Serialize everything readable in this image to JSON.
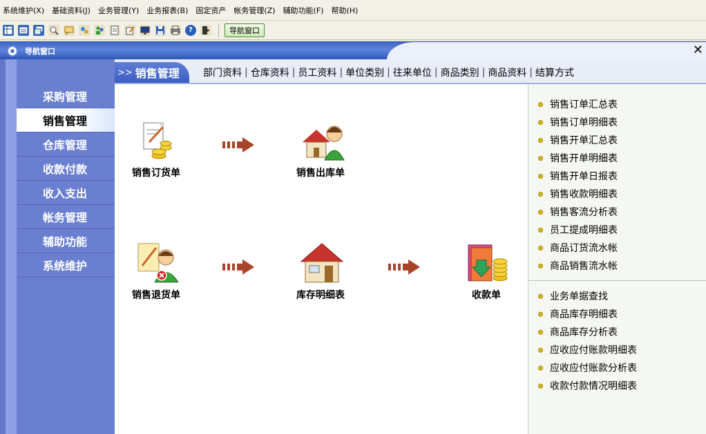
{
  "menu": [
    "系统维护(X)",
    "基础资料(J)",
    "业务管理(Y)",
    "业务报表(B)",
    "固定资产",
    "帐务管理(Z)",
    "辅助功能(F)",
    "帮助(H)"
  ],
  "toolbar": {
    "icons": [
      "grid-icon",
      "form-icon",
      "window-icon",
      "search-icon",
      "message-icon",
      "tools-icon",
      "users-icon",
      "print-preview-icon",
      "edit-icon",
      "monitor-icon",
      "save-icon",
      "printer-icon",
      "help-icon",
      "exit-icon"
    ],
    "nav_button": "导航窗口"
  },
  "window": {
    "title": "导航窗口",
    "close": "✕"
  },
  "sidebar": {
    "items": [
      {
        "label": "采购管理",
        "active": false
      },
      {
        "label": "销售管理",
        "active": true
      },
      {
        "label": "仓库管理",
        "active": false
      },
      {
        "label": "收款付款",
        "active": false
      },
      {
        "label": "收入支出",
        "active": false
      },
      {
        "label": "帐务管理",
        "active": false
      },
      {
        "label": "辅助功能",
        "active": false
      },
      {
        "label": "系统维护",
        "active": false
      }
    ]
  },
  "topnav": {
    "chevron": ">>",
    "section": "销售管理",
    "links": [
      "部门资料",
      "仓库资料",
      "员工资料",
      "单位类别",
      "往来单位",
      "商品类别",
      "商品资料",
      "结算方式"
    ],
    "separator": "|"
  },
  "diagram": {
    "nodes": {
      "sales_order": {
        "label": "销售订货单",
        "icon": "sales-order-icon"
      },
      "sales_outbound": {
        "label": "销售出库单",
        "icon": "sales-outbound-icon"
      },
      "sales_return": {
        "label": "销售退货单",
        "icon": "sales-return-icon"
      },
      "inventory_detail": {
        "label": "库存明细表",
        "icon": "inventory-house-icon"
      },
      "receipt": {
        "label": "收款单",
        "icon": "receipt-icon"
      }
    },
    "arrow_color": "#a8442a"
  },
  "reports": {
    "group1": [
      "销售订单汇总表",
      "销售订单明细表",
      "销售开单汇总表",
      "销售开单明细表",
      "销售开单日报表",
      "销售收款明细表",
      "销售客流分析表",
      "员工提成明细表",
      "商品订货流水帐",
      "商品销售流水帐"
    ],
    "group2": [
      "业务单据查找",
      "商品库存明细表",
      "商品库存分析表",
      "应收应付账款明细表",
      "应收应付账款分析表",
      "收款付款情况明细表"
    ]
  }
}
